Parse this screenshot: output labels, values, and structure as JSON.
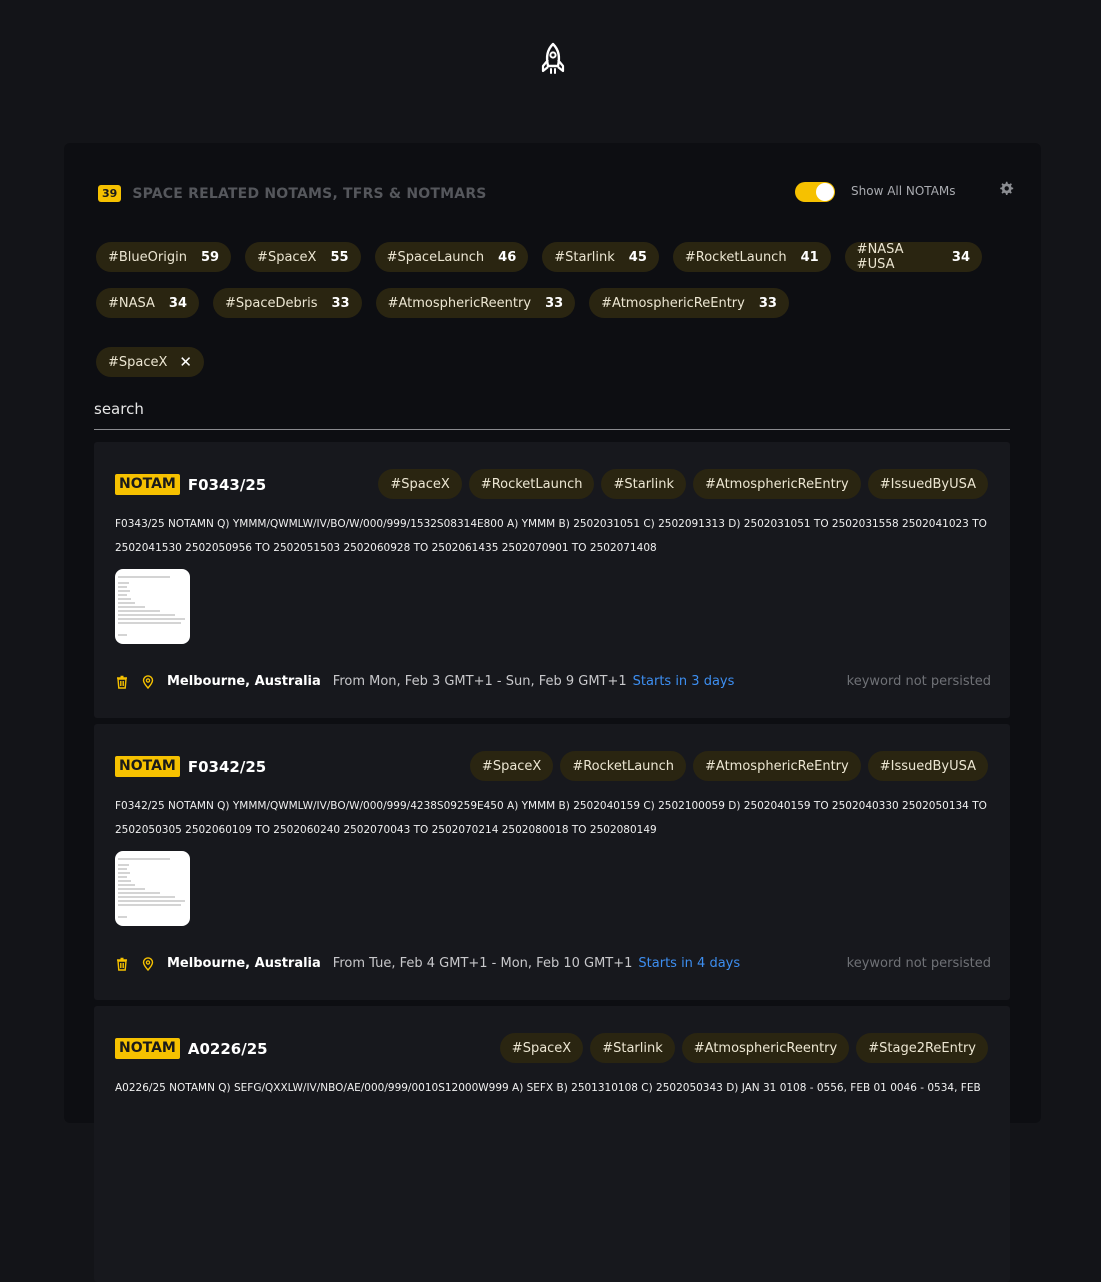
{
  "header": {
    "count": "39",
    "title": "SPACE RELATED NOTAMS, TFRS & NOTMARS",
    "toggle_label": "Show All NOTAMs",
    "toggle_on": true
  },
  "filters": [
    [
      {
        "label": "#BlueOrigin",
        "count": "59"
      },
      {
        "label": "#SpaceX",
        "count": "55"
      },
      {
        "label": "#SpaceLaunch",
        "count": "46"
      },
      {
        "label": "#Starlink",
        "count": "45"
      },
      {
        "label": "#RocketLaunch",
        "count": "41"
      },
      {
        "label": "#NASA #USA",
        "count": "34"
      }
    ],
    [
      {
        "label": "#NASA",
        "count": "34"
      },
      {
        "label": "#SpaceDebris",
        "count": "33"
      },
      {
        "label": "#AtmosphericReentry",
        "count": "33"
      },
      {
        "label": "#AtmosphericReEntry",
        "count": "33"
      }
    ]
  ],
  "active_filter": "#SpaceX",
  "search": {
    "placeholder": "search"
  },
  "notams": [
    {
      "type": "NOTAM",
      "id": "F0343/25",
      "tags": [
        "#SpaceX",
        "#RocketLaunch",
        "#Starlink",
        "#AtmosphericReEntry",
        "#IssuedByUSA"
      ],
      "text": "F0343/25 NOTAMN Q) YMMM/QWMLW/IV/BO/W/000/999/1532S08314E800 A) YMMM B) 2502031051 C) 2502091313 D) 2502031051 TO 2502031558 2502041023 TO 2502041530 2502050956 TO 2502051503 2502060928 TO 2502061435 2502070901 TO 2502071408",
      "location": "Melbourne, Australia",
      "range": "From Mon, Feb 3 GMT+1 - Sun, Feb 9 GMT+1",
      "starts": "Starts in 3 days",
      "note": "keyword not persisted"
    },
    {
      "type": "NOTAM",
      "id": "F0342/25",
      "tags": [
        "#SpaceX",
        "#RocketLaunch",
        "#AtmosphericReEntry",
        "#IssuedByUSA"
      ],
      "text": "F0342/25 NOTAMN Q) YMMM/QWMLW/IV/BO/W/000/999/4238S09259E450 A) YMMM B) 2502040159 C) 2502100059 D) 2502040159 TO 2502040330 2502050134 TO 2502050305 2502060109 TO 2502060240 2502070043 TO 2502070214 2502080018 TO 2502080149",
      "location": "Melbourne, Australia",
      "range": "From Tue, Feb 4 GMT+1 - Mon, Feb 10 GMT+1",
      "starts": "Starts in 4 days",
      "note": "keyword not persisted"
    },
    {
      "type": "NOTAM",
      "id": "A0226/25",
      "tags": [
        "#SpaceX",
        "#Starlink",
        "#AtmosphericReentry",
        "#Stage2ReEntry"
      ],
      "text": "A0226/25 NOTAMN Q) SEFG/QXXLW/IV/NBO/AE/000/999/0010S12000W999 A) SEFX B) 2501310108 C) 2502050343 D) JAN 31 0108 - 0556, FEB 01 0046 - 0534, FEB",
      "location": "",
      "range": "",
      "starts": "",
      "note": ""
    }
  ]
}
